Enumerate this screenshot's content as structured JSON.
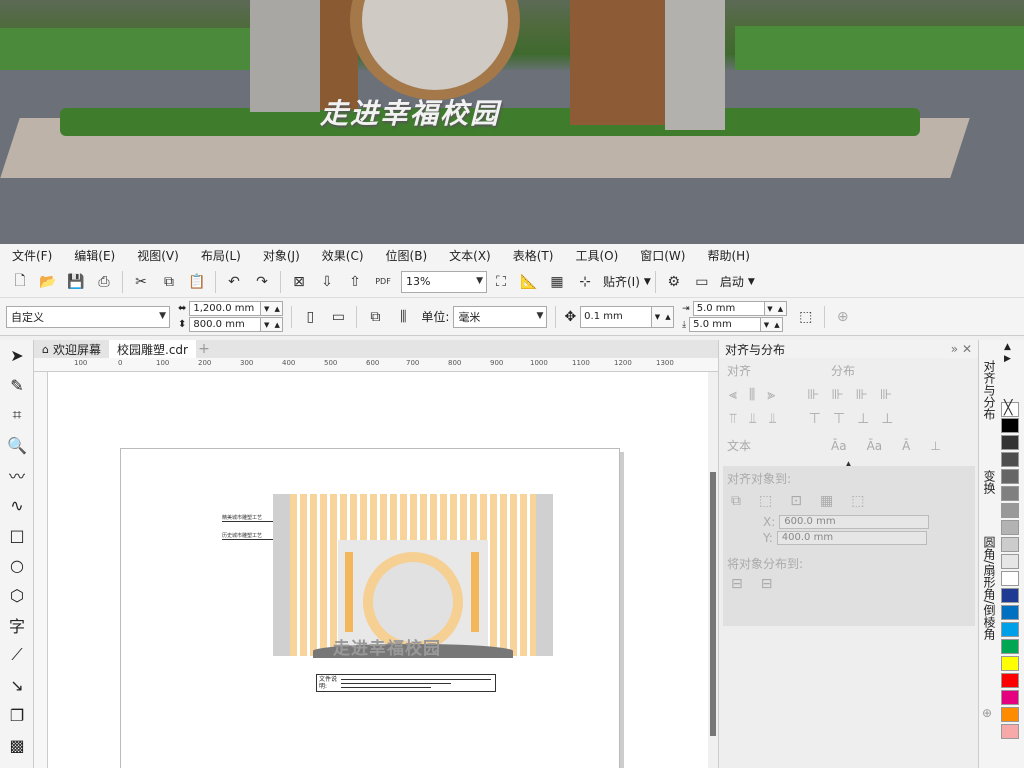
{
  "photo": {
    "sign_text": "走进幸福校园"
  },
  "menu": [
    "文件(F)",
    "编辑(E)",
    "视图(V)",
    "布局(L)",
    "对象(J)",
    "效果(C)",
    "位图(B)",
    "文本(X)",
    "表格(T)",
    "工具(O)",
    "窗口(W)",
    "帮助(H)"
  ],
  "toolbar": {
    "zoom": "13%",
    "snap_label": "贴齐(I)",
    "launch_label": "启动"
  },
  "property_bar": {
    "page_preset": "自定义",
    "width": "1,200.0 mm",
    "height": "800.0 mm",
    "units_label": "单位:",
    "units": "毫米",
    "nudge": "0.1 mm",
    "dup_x": "5.0 mm",
    "dup_y": "5.0 mm"
  },
  "tabs": [
    {
      "label": "欢迎屏幕"
    },
    {
      "label": "校园雕塑.cdr"
    }
  ],
  "ruler_ticks": [
    "100",
    "0",
    "100",
    "200",
    "300",
    "400",
    "500",
    "600",
    "700",
    "800",
    "900",
    "1000",
    "1100",
    "1200",
    "1300"
  ],
  "design": {
    "title": "走进幸福校园",
    "annot1": "精美城市雕塑工艺",
    "annot2": "历史城市雕塑工艺",
    "legend_label": "文件说明:"
  },
  "dock": {
    "title": "对齐与分布",
    "align": "对齐",
    "distribute": "分布",
    "text": "文本",
    "align_to": "对齐对象到:",
    "x_value": "600.0 mm",
    "y_value": "400.0 mm",
    "distribute_to": "将对象分布到:"
  },
  "side_tabs": [
    "对齐与分布",
    "变换",
    "圆角/扇形角/倒棱角"
  ],
  "palette": [
    "#ffffff",
    "#000000",
    "#333333",
    "#4d4d4d",
    "#666666",
    "#808080",
    "#999999",
    "#b3b3b3",
    "#cccccc",
    "#e6e6e6",
    "#ffffff",
    "#1f3a93",
    "#0070c0",
    "#00a0e9",
    "#00a651",
    "#ffff00",
    "#ff0000",
    "#e4007f",
    "#ff8c00",
    "#f7a8a8"
  ]
}
